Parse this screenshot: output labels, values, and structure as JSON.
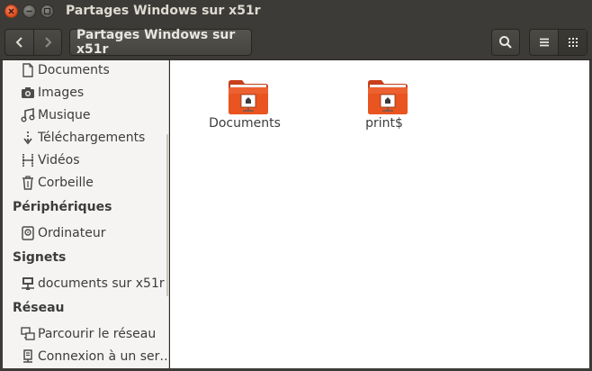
{
  "window": {
    "title": "Partages Windows sur x51r"
  },
  "toolbar": {
    "path_label": "Partages Windows sur x51r"
  },
  "sidebar": {
    "places": [
      {
        "label": "Documents",
        "icon": "document-icon"
      },
      {
        "label": "Images",
        "icon": "camera-icon"
      },
      {
        "label": "Musique",
        "icon": "music-icon"
      },
      {
        "label": "Téléchargements",
        "icon": "download-icon"
      },
      {
        "label": "Vidéos",
        "icon": "film-icon"
      },
      {
        "label": "Corbeille",
        "icon": "trash-icon"
      }
    ],
    "devices_heading": "Périphériques",
    "devices": [
      {
        "label": "Ordinateur",
        "icon": "computer-icon"
      }
    ],
    "bookmarks_heading": "Signets",
    "bookmarks": [
      {
        "label": "documents sur x51r",
        "icon": "network-share-icon"
      }
    ],
    "network_heading": "Réseau",
    "network": [
      {
        "label": "Parcourir le réseau",
        "icon": "network-icon"
      },
      {
        "label": "Connexion à un ser…",
        "icon": "server-icon"
      }
    ]
  },
  "files": [
    {
      "name": "Documents",
      "icon": "shared-folder-icon"
    },
    {
      "name": "print$",
      "icon": "shared-folder-icon"
    }
  ],
  "colors": {
    "folder": "#e95420",
    "titlebar": "#3c3b37",
    "sidebar": "#f5f4f2"
  }
}
